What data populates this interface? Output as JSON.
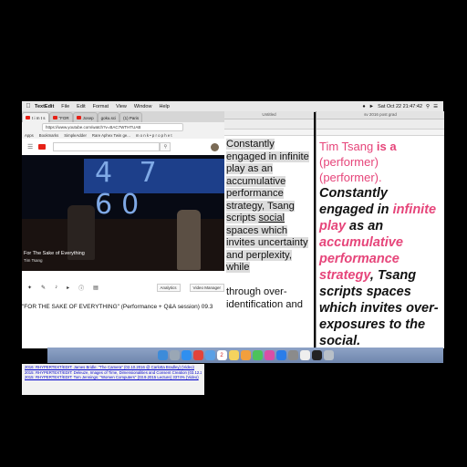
{
  "menubar": {
    "app": "TextEdit",
    "items": [
      "File",
      "Edit",
      "Format",
      "View",
      "Window",
      "Help"
    ],
    "clock": "Sat Oct 22  21:47:42"
  },
  "browser": {
    "tabs": [
      "t i m t s",
      "\"FOR",
      "Josep",
      "goku.sci",
      "(1) Paris"
    ],
    "url": "https://www.youtube.com/watch?v=BAC7WTHTUAB",
    "bookmarks": [
      "Apps",
      "Bookmarks",
      "SimpleAdder",
      "Rare Aphex Twin ge...",
      "m o n k • p r o p h e t"
    ],
    "video_title": "For The Sake of Everything",
    "video_subtitle": "Tim Tsang",
    "screen_digits": "4 7 60",
    "controls": [
      "Analytics",
      "Video Manager"
    ],
    "full_title": "\"FOR THE SAKE OF EVERYTHING\" (Performance + Q&A session) 09.3"
  },
  "textedit1": {
    "title": "Untitled",
    "line_a": "Constantly engaged in infinite play as an accumulative performance strategy, Tsang scripts ",
    "underlined": "social",
    "line_b": " spaces which invites uncertainty and perplexity, while",
    "line_c": "through over-identification and"
  },
  "textedit2": {
    "title": "sv 2016 post grad",
    "name": "Tim Tsang ",
    "is_a": "is a",
    "performer1": "(performer)",
    "performer2": "(performer).",
    "s1": "Constantly engaged in ",
    "s2": "infinite play",
    "s3": " as an ",
    "s4": "accumulative performance strategy",
    "s5": ", Tsang scripts spaces which invites over-exposures to the social."
  },
  "links": [
    "2016: RHYPERTEXT/EDIT: James Bridle: \"The Camera\" (02.10.2016 @ Carlotta Bradley) (Video)",
    "2015: RHYPERTEXT/EDIT: Deleuze, Images of Time, Dimensionalities and Consent Creation (03.12.2015) (Video)",
    "2015: RHYPERTEXT/EDIT: Tom Jennings: \"Women Computers\" (03.9.2015 Lecture) 3374% (Video)"
  ],
  "dock_icons": [
    "finder-icon",
    "launchpad-icon",
    "safari-icon",
    "chrome-icon",
    "mail-icon",
    "calendar-icon",
    "notes-icon",
    "photos-icon",
    "messages-icon",
    "itunes-icon",
    "appstore-icon",
    "settings-icon",
    "textedit-icon",
    "terminal-icon",
    "trash-icon"
  ]
}
